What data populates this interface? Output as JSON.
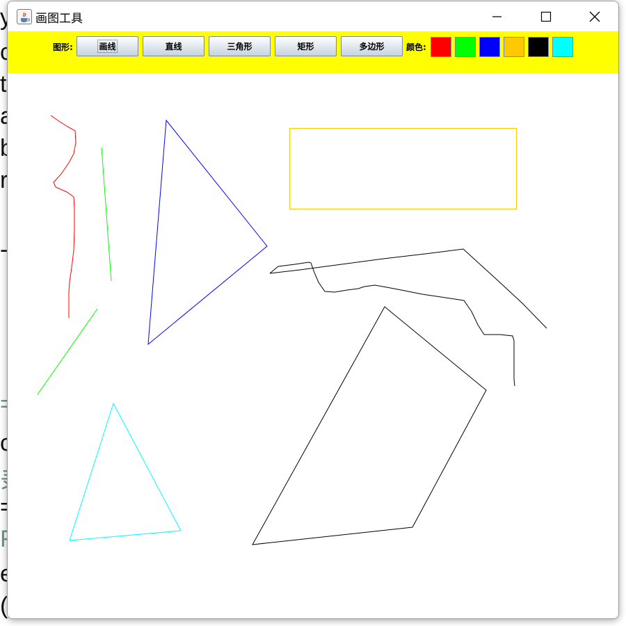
{
  "window": {
    "title": "画图工具"
  },
  "toolbar": {
    "shape_label": "图形:",
    "color_label": "颜色:",
    "buttons": [
      "画线",
      "直线",
      "三角形",
      "矩形",
      "多边形"
    ],
    "selected_button": "画线",
    "colors": [
      "#ff0000",
      "#00ff00",
      "#0000ff",
      "#ffc800",
      "#000000",
      "#00ffff"
    ],
    "background": "#ffff00"
  },
  "background_text": [
    "y",
    "c",
    "t",
    "a",
    "b",
    "r",
    "-",
    "=",
    "c",
    "录",
    "=",
    "F",
    "e",
    "("
  ],
  "canvas": {
    "drawings": [
      {
        "type": "freehand",
        "color": "#ff0000"
      },
      {
        "type": "line",
        "color": "#00ff00"
      },
      {
        "type": "line",
        "color": "#00ff00"
      },
      {
        "type": "triangle",
        "color": "#0000ff"
      },
      {
        "type": "rectangle",
        "color": "#ffc800"
      },
      {
        "type": "freehand",
        "color": "#000000"
      },
      {
        "type": "polygon",
        "color": "#000000"
      },
      {
        "type": "triangle",
        "color": "#00ffff"
      }
    ]
  }
}
